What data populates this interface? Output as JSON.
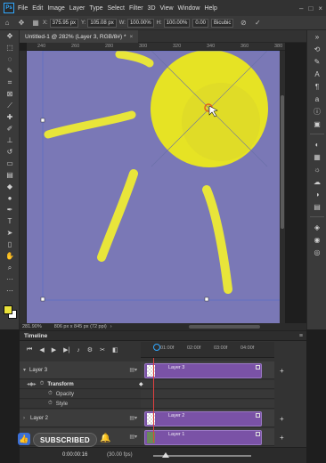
{
  "menubar": {
    "logo": "Ps",
    "items": [
      "File",
      "Edit",
      "Image",
      "Layer",
      "Type",
      "Select",
      "Filter",
      "3D",
      "View",
      "Window",
      "Help"
    ],
    "controls": [
      "–",
      "□",
      "×"
    ]
  },
  "options": {
    "x_label": "X:",
    "x_value": "375.95 px",
    "y_label": "Y:",
    "y_value": "105.08 px",
    "w_label": "W:",
    "w_value": "100.00%",
    "h_label": "H:",
    "h_value": "100.00%",
    "angle_value": "0.00",
    "interp_value": "Bicubic",
    "commit": "✓",
    "cancel": "⊘"
  },
  "document": {
    "tab_title": "Untitled-1 @ 282% (Layer 3, RGB/8#) *",
    "ruler_ticks": [
      "240",
      "260",
      "280",
      "300",
      "320",
      "340",
      "360",
      "380"
    ],
    "zoom": "281.90%",
    "doc_info": "806 px x 845 px (72 ppi)"
  },
  "colors": {
    "canvas_bg": "#7a78b6",
    "sun": "#e6e324",
    "sun_inner": "#d9d62a",
    "ray": "#e8e53a",
    "foreground": "#eae23a",
    "accent": "#31a8ff",
    "clip": "#7a52a6"
  },
  "timeline": {
    "title": "Timeline",
    "ticks": [
      "01:00f",
      "02:00f",
      "03:00f",
      "04:00f"
    ],
    "rows": [
      {
        "label": "Layer 3",
        "clip_label": "Layer 3"
      },
      {
        "label": "Transform"
      },
      {
        "label": "Opacity"
      },
      {
        "label": "Style"
      },
      {
        "label": "Layer 2",
        "clip_label": "Layer 2"
      },
      {
        "label": "Layer 1",
        "clip_label": "Layer 1"
      }
    ],
    "time": "0:00:00:16",
    "fps": "(30.00 fps)"
  },
  "overlay": {
    "subscribe_label": "SUBSCRIBED"
  }
}
